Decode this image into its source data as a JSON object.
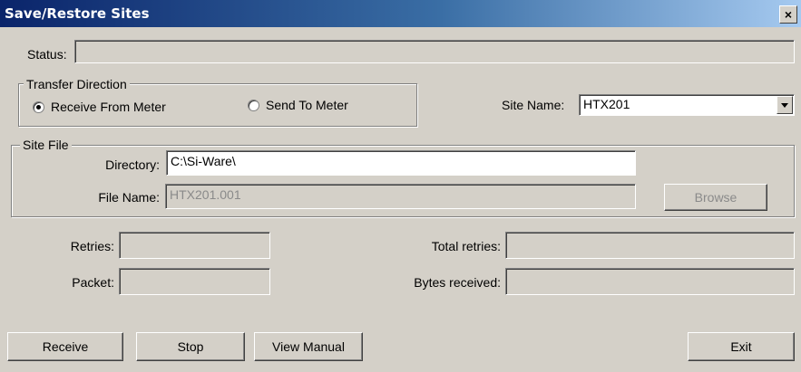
{
  "window": {
    "title": "Save/Restore Sites",
    "close_glyph": "×"
  },
  "status": {
    "label": "Status:",
    "value": ""
  },
  "transfer": {
    "legend": "Transfer Direction",
    "receive_label": "Receive From Meter",
    "send_label": "Send To Meter",
    "selected": "receive"
  },
  "site_name": {
    "label": "Site Name:",
    "value": "HTX201"
  },
  "site_file": {
    "legend": "Site File",
    "directory_label": "Directory:",
    "directory_value": "C:\\Si-Ware\\",
    "filename_label": "File Name:",
    "filename_value": "HTX201.001",
    "browse_label": "Browse"
  },
  "stats": {
    "retries_label": "Retries:",
    "retries_value": "",
    "packet_label": "Packet:",
    "packet_value": "",
    "total_retries_label": "Total retries:",
    "total_retries_value": "",
    "bytes_label": "Bytes received:",
    "bytes_value": ""
  },
  "buttons": {
    "receive": "Receive",
    "stop": "Stop",
    "view_manual": "View Manual",
    "exit": "Exit"
  }
}
